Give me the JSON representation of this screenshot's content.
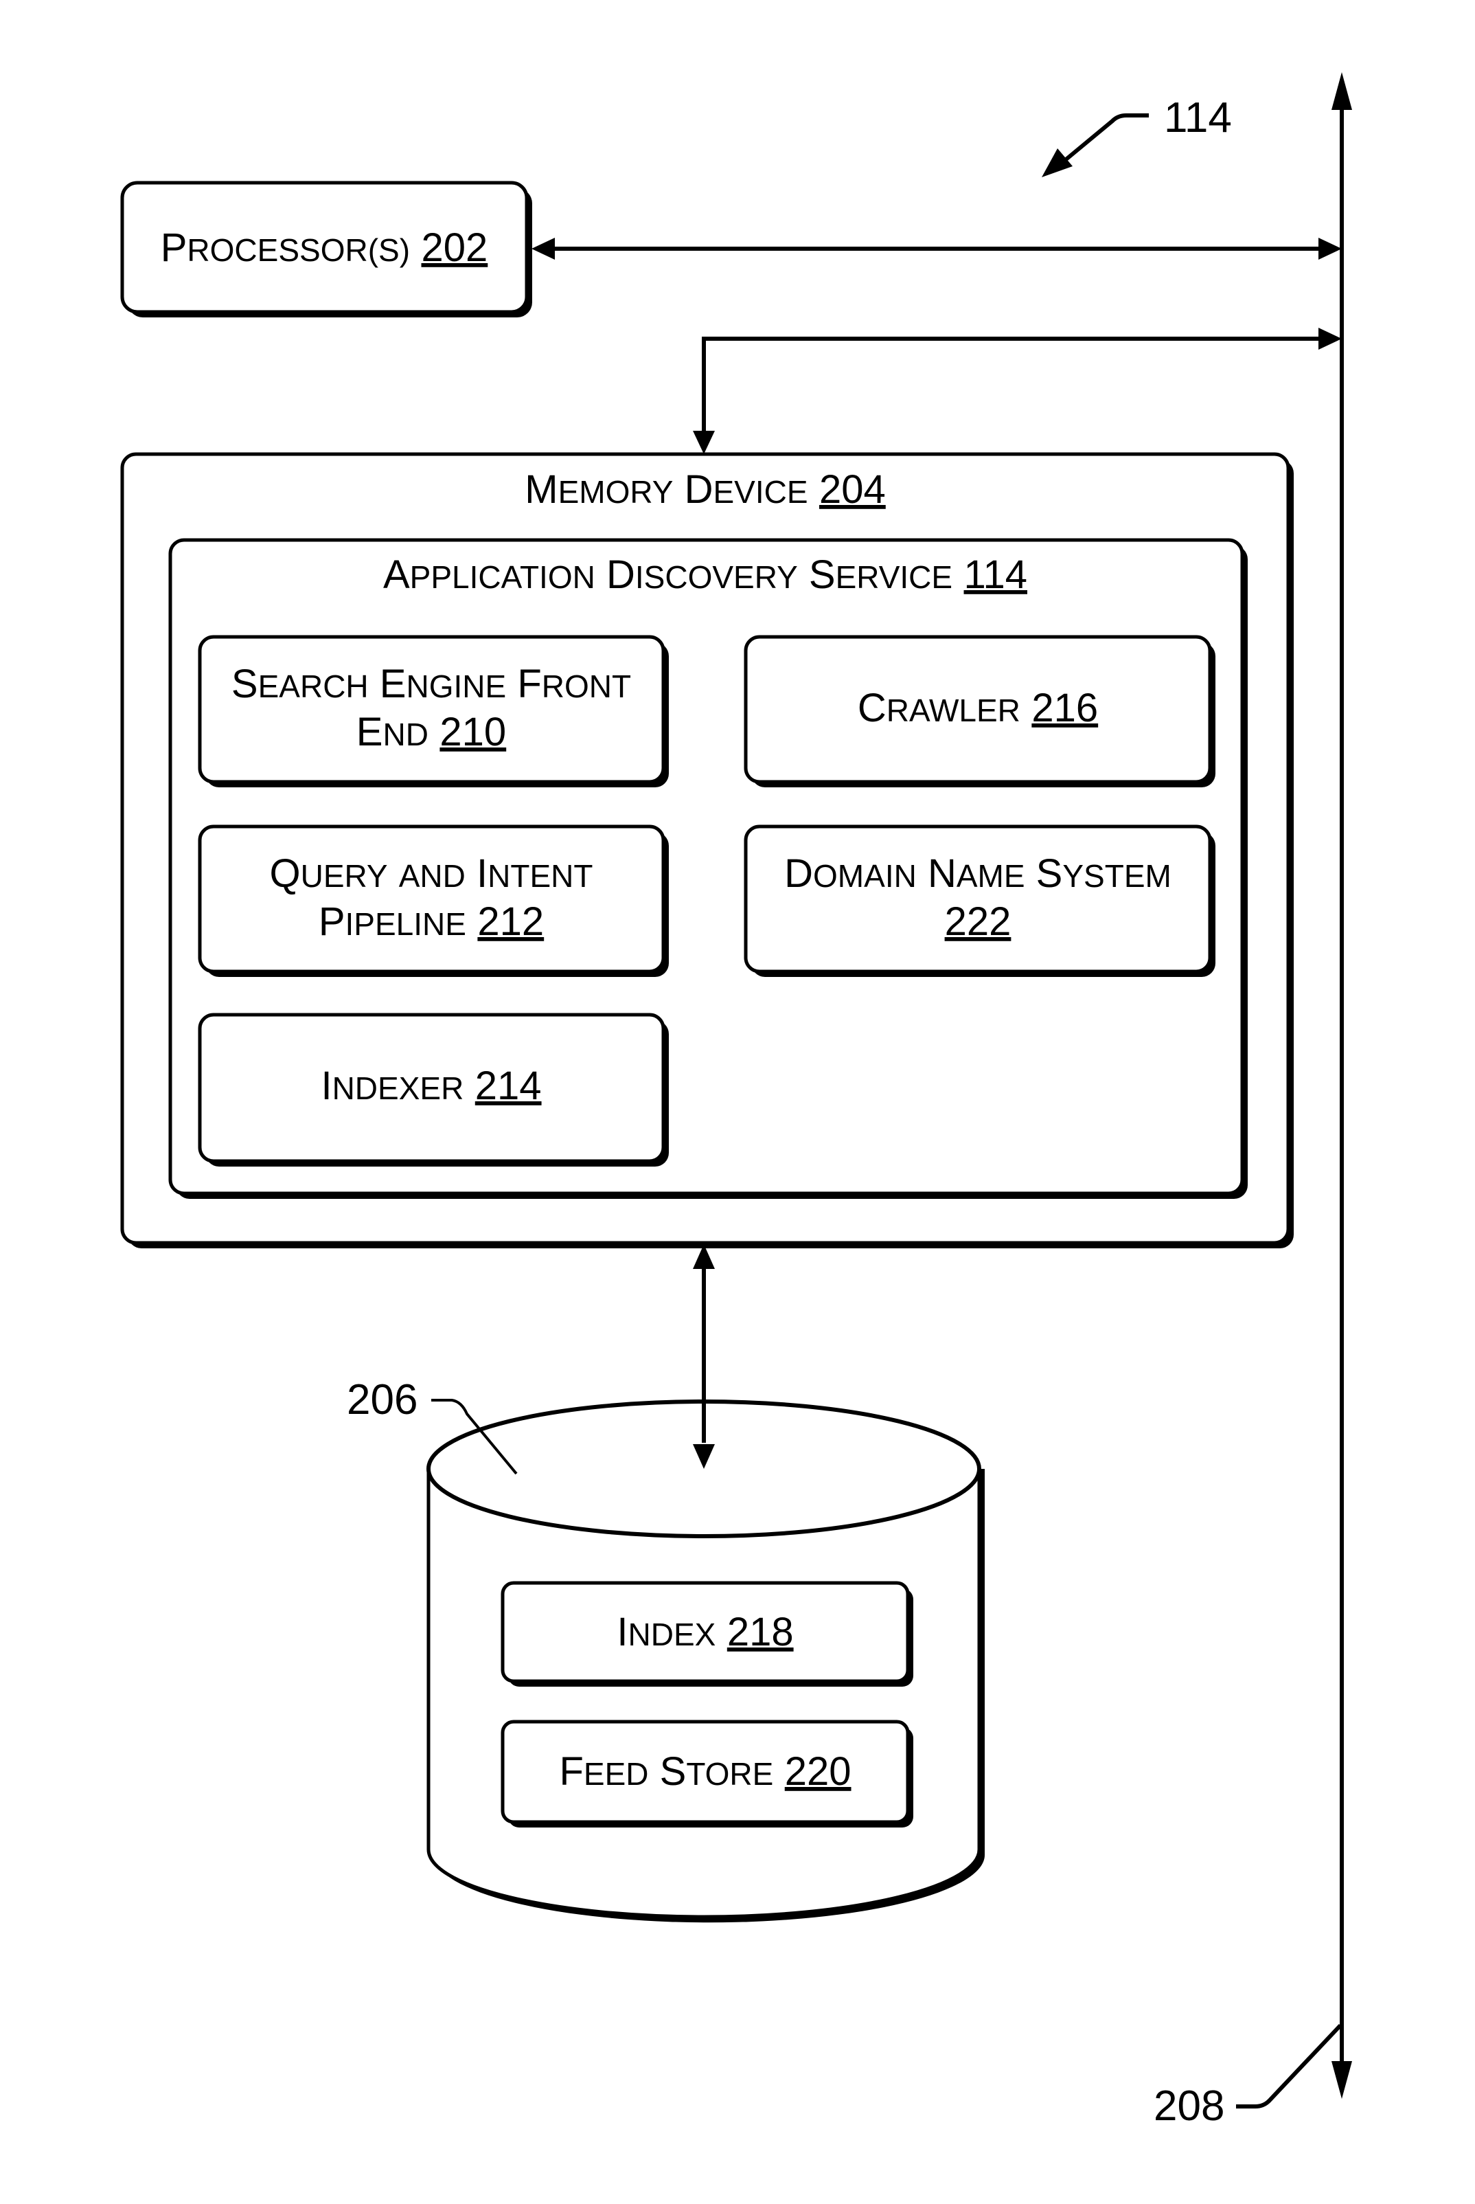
{
  "figure": {
    "reference_label": "114",
    "bus_label": "208",
    "storage_label": "206"
  },
  "processor": {
    "name": "Processor(s)",
    "number": "202"
  },
  "memory": {
    "name": "Memory Device",
    "number": "204",
    "service": {
      "name": "Application Discovery Service",
      "number": "114",
      "modules": [
        {
          "line1": "Search Engine Front",
          "line2": "End",
          "number": "210"
        },
        {
          "line1": "Crawler",
          "line2": "",
          "number": "216"
        },
        {
          "line1": "Query and Intent",
          "line2": "Pipeline",
          "number": "212"
        },
        {
          "line1": "Domain Name System",
          "line2": "",
          "number": "222"
        },
        {
          "line1": "Indexer",
          "line2": "",
          "number": "214"
        }
      ]
    }
  },
  "storage": {
    "items": [
      {
        "name": "Index",
        "number": "218"
      },
      {
        "name": "Feed Store",
        "number": "220"
      }
    ]
  }
}
